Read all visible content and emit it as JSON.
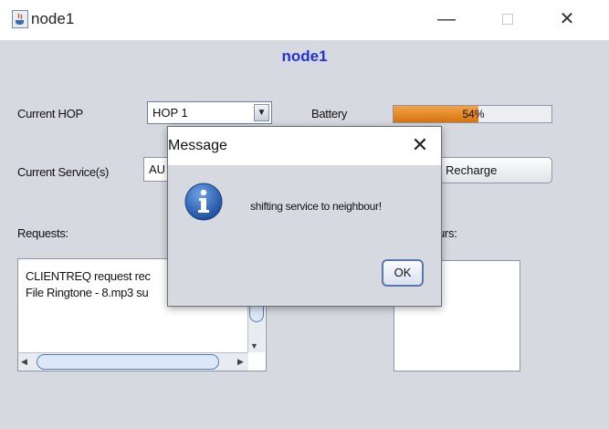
{
  "window": {
    "title": "node1",
    "top_fragment": "node1",
    "controls": {
      "minimize": "—",
      "close": "✕"
    }
  },
  "main": {
    "heading": "node1",
    "current_hop_label": "Current HOP",
    "hop_selected": "HOP 1",
    "battery_label": "Battery",
    "battery_percent": 0.54,
    "battery_text": "54%",
    "current_service_label": "Current Service(s)",
    "service_value": "AU",
    "recharge_label": "Recharge",
    "requests_label": "Requests:",
    "requests_lines": [
      "CLIENTREQ request rec",
      "File Ringtone - 8.mp3 su"
    ],
    "neighbours_label": "urs:"
  },
  "dialog": {
    "title": "Message",
    "message": "shifting service to neighbour!",
    "ok_label": "OK",
    "icon": "info-icon"
  },
  "colors": {
    "heading": "#2432d8",
    "battery_fill": "#d8730e",
    "background": "#d6d9df"
  }
}
